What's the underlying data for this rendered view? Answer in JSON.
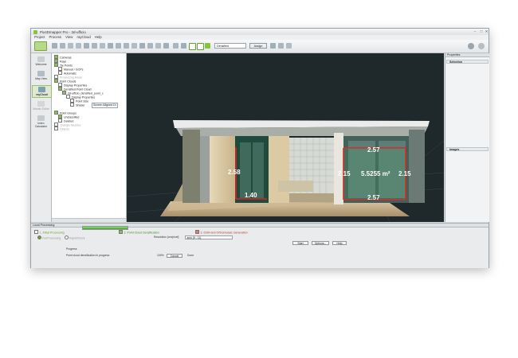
{
  "window": {
    "title": "Pix4Dmapper Pro - 3d-ufficio",
    "controls": [
      "–",
      "□",
      "✕"
    ]
  },
  "menu": [
    "Project",
    "Process",
    "View",
    "rayCloud",
    "Help"
  ],
  "toolbar": {
    "display_select": "Densified",
    "assign_label": "Assign"
  },
  "sidebar": [
    {
      "label": "Welcome",
      "icon": "home-icon",
      "active": false
    },
    {
      "label": "Map View",
      "icon": "map-icon",
      "active": false
    },
    {
      "label": "rayCloud",
      "icon": "raycloud-icon",
      "active": true
    },
    {
      "label": "Mosaic Editor",
      "icon": "mosaic-icon",
      "active": false
    },
    {
      "label": "Index Calculator",
      "icon": "calculator-icon",
      "active": false
    }
  ],
  "layers": [
    {
      "label": "Cameras",
      "indent": 0,
      "checked": true,
      "dim": false
    },
    {
      "label": "Rays",
      "indent": 0,
      "checked": true,
      "dim": false
    },
    {
      "label": "Tie Points",
      "indent": 0,
      "checked": true,
      "dim": false
    },
    {
      "label": "Manual / GCPs",
      "indent": 1,
      "checked": false,
      "dim": false
    },
    {
      "label": "Automatic",
      "indent": 1,
      "checked": false,
      "dim": false
    },
    {
      "label": "Processing Areas",
      "indent": 0,
      "checked": false,
      "dim": true
    },
    {
      "label": "Point Clouds",
      "indent": 0,
      "checked": true,
      "dim": false
    },
    {
      "label": "Display Properties",
      "indent": 1,
      "checked": false,
      "dim": false
    },
    {
      "label": "Densified Point Cloud",
      "indent": 1,
      "checked": true,
      "dim": false
    },
    {
      "label": "3d-ufficio_densified_point_c",
      "indent": 2,
      "checked": true,
      "dim": false
    },
    {
      "label": "Display Properties",
      "indent": 3,
      "checked": false,
      "dim": false
    },
    {
      "label": "Point Size",
      "indent": 4,
      "checked": false,
      "dim": false
    },
    {
      "label": "Shader",
      "indent": 4,
      "checked": false,
      "dim": false
    },
    {
      "label": "",
      "indent": 0,
      "checked": false,
      "dim": false
    },
    {
      "label": "Point Groups",
      "indent": 0,
      "checked": true,
      "dim": false
    },
    {
      "label": "Unclassified",
      "indent": 1,
      "checked": true,
      "dim": false
    },
    {
      "label": "Deleted",
      "indent": 1,
      "checked": false,
      "dim": false
    },
    {
      "label": "Triangle Meshes",
      "indent": 0,
      "checked": false,
      "dim": true
    },
    {
      "label": "Objects",
      "indent": 0,
      "checked": false,
      "dim": true
    }
  ],
  "shader_value": "Screen Aligned Di",
  "measurements": {
    "left_height": "2.58",
    "left_width": "1.40",
    "right_top": "2.57",
    "right_bottom": "2.57",
    "right_left": "2.15",
    "right_right": "2.15",
    "area": "5.5255 m²"
  },
  "properties_panel": {
    "title": "Properties",
    "section_selection": "Selection",
    "section_images": "Images"
  },
  "local_processing": {
    "title": "Local Processing",
    "steps": [
      {
        "label": "1. Initial Processing",
        "checked": false,
        "color": "#6aa12a"
      },
      {
        "label": "2. Point Cloud Densification",
        "checked": true,
        "color": "#3f8a2a"
      },
      {
        "label": "3. DSM and Orthomosaic Generation",
        "checked": true,
        "color": "#c0392b"
      }
    ],
    "option_full": "Full Processing",
    "option_rapid": "Rapid/Check",
    "resolution_label": "Resolution [cm/pixel]",
    "resolution_value": "auto [5 - 11]",
    "start_label": "Start",
    "options_label": "Options...",
    "help_label": "Help",
    "progress_title": "Progress",
    "progress_text": "Point cloud densification in progress",
    "progress_percent": "100%",
    "progress_value": 1.0,
    "cancel_label": "Cancel",
    "status_label": "Done"
  }
}
